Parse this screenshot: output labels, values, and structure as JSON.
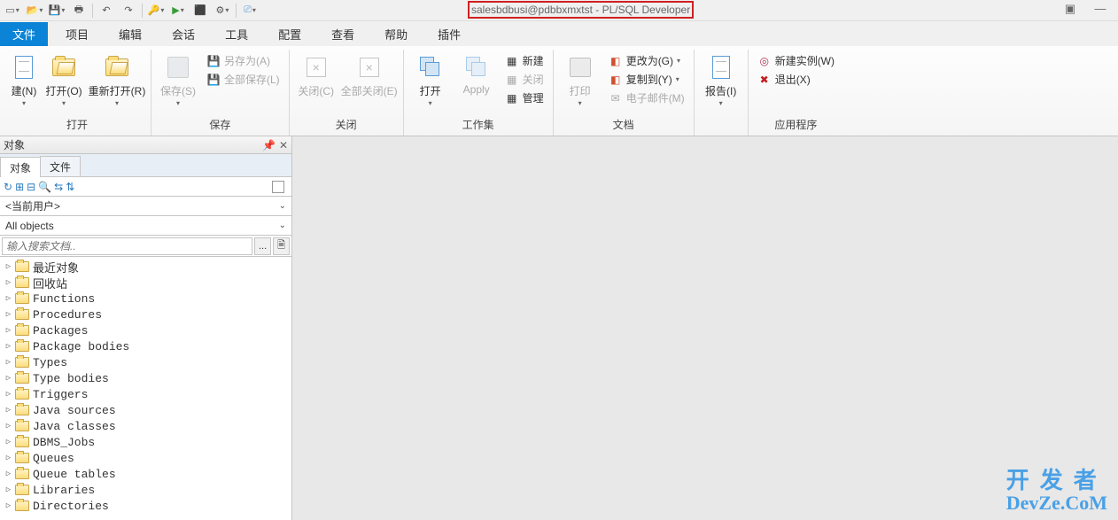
{
  "title": "salesbdbusi@pdbbxmxtst - PL/SQL Developer",
  "menu": [
    "文件",
    "项目",
    "编辑",
    "会话",
    "工具",
    "配置",
    "查看",
    "帮助",
    "插件"
  ],
  "ribbon": {
    "open": {
      "title": "打开",
      "new": "建(N)",
      "open": "打开(O)",
      "reopen": "重新打开(R)"
    },
    "save": {
      "title": "保存",
      "save": "保存(S)",
      "saveas": "另存为(A)",
      "saveall": "全部保存(L)"
    },
    "close": {
      "title": "关闭",
      "close": "关闭(C)",
      "closeall": "全部关闭(E)"
    },
    "work": {
      "title": "工作集",
      "open": "打开",
      "apply": "Apply",
      "new": "新建",
      "close": "关闭",
      "manage": "管理"
    },
    "doc": {
      "title": "文档",
      "print": "打印",
      "changeto": "更改为(G)",
      "copyto": "复制到(Y)",
      "email": "电子邮件(M)"
    },
    "report": {
      "title": "",
      "report": "报告(I)"
    },
    "app": {
      "title": "应用程序",
      "newinst": "新建实例(W)",
      "exit": "退出(X)"
    }
  },
  "objects": {
    "title": "对象",
    "tabs": [
      "对象",
      "文件"
    ],
    "user": "<当前用户>",
    "scope": "All objects",
    "search_ph": "输入搜索文档..",
    "tree": [
      "最近对象",
      "回收站",
      "Functions",
      "Procedures",
      "Packages",
      "Package bodies",
      "Types",
      "Type bodies",
      "Triggers",
      "Java sources",
      "Java classes",
      "DBMS_Jobs",
      "Queues",
      "Queue tables",
      "Libraries",
      "Directories"
    ]
  },
  "watermark": {
    "cn": "开发者",
    "en": "DevZe.CoM"
  }
}
